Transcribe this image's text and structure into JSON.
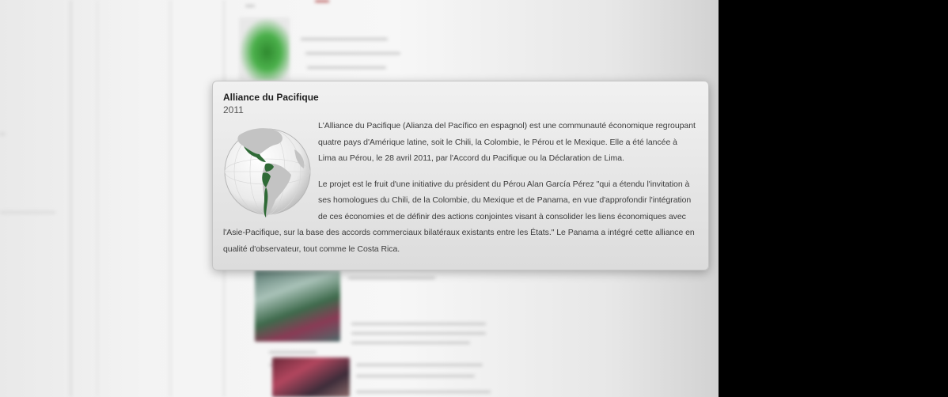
{
  "popover": {
    "title": "Alliance du Pacifique",
    "year": "2011",
    "paragraph_1": "L'Alliance du Pacifique (Alianza del Pacífico en espagnol) est une communauté économique regroupant quatre pays d'Amérique latine, soit le Chili, la Colombie, le Pérou et le Mexique. Elle a été lancée à Lima au Pérou, le 28 avril 2011, par l'Accord du Pacifique ou la Déclaration de Lima.",
    "paragraph_2": "Le projet est le fruit d'une initiative du président du Pérou Alan García Pérez \"qui a étendu l'invitation à ses homologues du Chili, de la Colombie, du Mexique et de Panama, en vue d'approfondir l'intégration de ces économies et de définir des actions conjointes visant à consolider les liens économiques avec l'Asie-Pacifique, sur la base des accords commerciaux bilatéraux existants entre les États.\" Le Panama a intégré cette alliance en qualité d'observateur, tout comme le Costa Rica.",
    "globe_icon": "globe-map-icon"
  },
  "colors": {
    "member_green": "#2f6a36",
    "land_grey": "#c9c9c9",
    "backdrop": "#000000"
  }
}
